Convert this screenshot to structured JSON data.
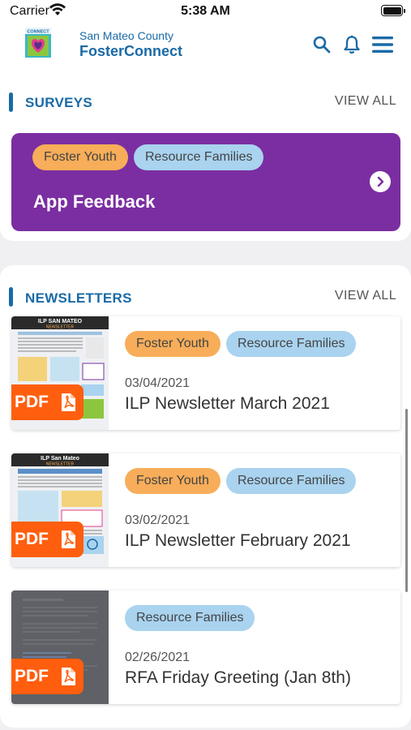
{
  "status": {
    "carrier": "Carrier",
    "time": "5:38 AM"
  },
  "header": {
    "org": "San Mateo County",
    "app": "FosterConnect",
    "logo_text": "CONNECT"
  },
  "surveys": {
    "title": "SURVEYS",
    "view_all": "VIEW ALL",
    "card": {
      "tags": [
        "Foster Youth",
        "Resource Families"
      ],
      "title": "App Feedback"
    }
  },
  "newsletters": {
    "title": "NEWSLETTERS",
    "view_all": "VIEW ALL",
    "items": [
      {
        "tags": [
          "Foster Youth",
          "Resource Families"
        ],
        "date": "03/04/2021",
        "title": "ILP Newsletter March 2021",
        "badge": "PDF",
        "thumb_heading": "ILP SAN MATEO",
        "thumb_sub": "NEWSLETTER"
      },
      {
        "tags": [
          "Foster Youth",
          "Resource Families"
        ],
        "date": "03/02/2021",
        "title": "ILP Newsletter February 2021",
        "badge": "PDF",
        "thumb_heading": "ILP San Mateo",
        "thumb_sub": "NEWSLETTER"
      },
      {
        "tags": [
          "Resource Families"
        ],
        "date": "02/26/2021",
        "title": "RFA Friday Greeting (Jan 8th)",
        "badge": "PDF"
      }
    ]
  },
  "colors": {
    "brand_blue": "#1a6aa6",
    "survey_purple": "#7b2ea1",
    "tag_orange": "#f7ad59",
    "tag_blue": "#a9d3ef",
    "pdf_orange": "#ff5e0e"
  },
  "icons": [
    "wifi-icon",
    "battery-icon",
    "search-icon",
    "bell-icon",
    "menu-icon",
    "chevron-right-icon",
    "pdf-file-icon"
  ]
}
